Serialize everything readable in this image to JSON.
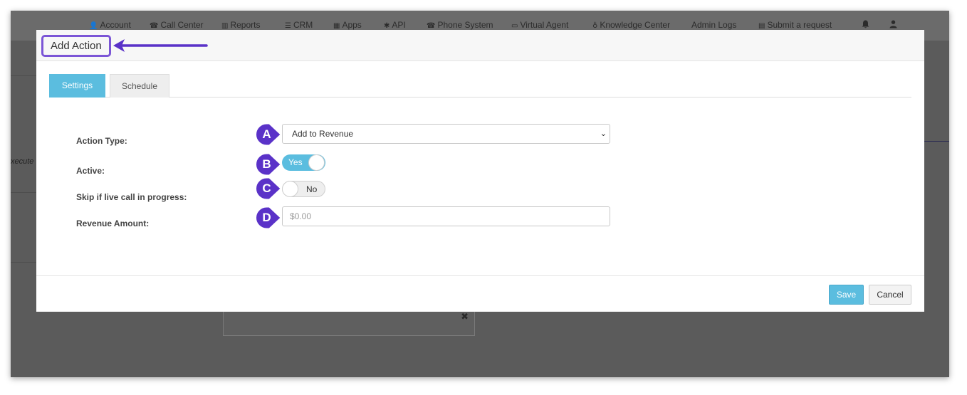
{
  "topnav": {
    "items": [
      {
        "icon": "user-icon",
        "glyph": "👤",
        "label": "Account"
      },
      {
        "icon": "phone-icon",
        "glyph": "☎",
        "label": "Call Center"
      },
      {
        "icon": "bar-chart-icon",
        "glyph": "▥",
        "label": "Reports"
      },
      {
        "icon": "list-icon",
        "glyph": "☰",
        "label": "CRM"
      },
      {
        "icon": "grid-icon",
        "glyph": "▦",
        "label": "Apps"
      },
      {
        "icon": "gear-icon",
        "glyph": "✱",
        "label": "API"
      },
      {
        "icon": "phone-icon",
        "glyph": "☎",
        "label": "Phone System"
      },
      {
        "icon": "monitor-icon",
        "glyph": "▭",
        "label": "Virtual Agent"
      },
      {
        "icon": "lightbulb-icon",
        "glyph": "♁",
        "label": "Knowledge Center"
      },
      {
        "icon": "",
        "glyph": "",
        "label": "Admin Logs"
      },
      {
        "icon": "ticket-icon",
        "glyph": "▤",
        "label": "Submit a request"
      }
    ],
    "bell_icon": "bell-icon",
    "user_menu_icon": "user-icon"
  },
  "background": {
    "side_text": "xecute"
  },
  "modal": {
    "title": "Add Action",
    "tabs": [
      {
        "label": "Settings",
        "active": true
      },
      {
        "label": "Schedule",
        "active": false
      }
    ],
    "fields": {
      "action_type": {
        "label": "Action Type:",
        "value": "Add to Revenue",
        "marker": "A"
      },
      "active": {
        "label": "Active:",
        "value": "Yes",
        "marker": "B"
      },
      "skip_live_call": {
        "label": "Skip if live call in progress:",
        "value": "No",
        "marker": "C"
      },
      "revenue_amount": {
        "label": "Revenue Amount:",
        "placeholder": "$0.00",
        "value": "",
        "marker": "D"
      }
    },
    "footer": {
      "save_label": "Save",
      "cancel_label": "Cancel"
    }
  },
  "colors": {
    "accent": "#5bbddf",
    "annotation": "#5a32c8"
  }
}
